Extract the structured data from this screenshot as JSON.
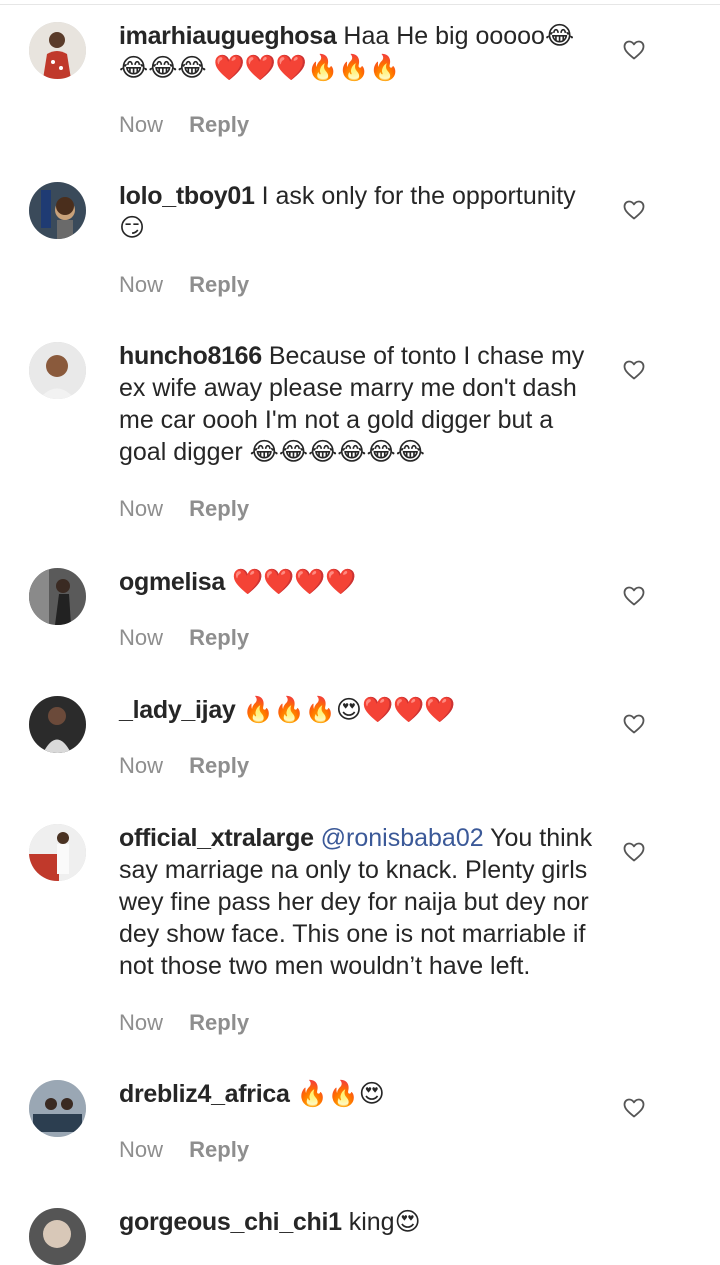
{
  "comments": [
    {
      "username": "imarhiaugueghosa",
      "text": "Haa He big ooooo😂😂😂😂 ❤️❤️❤️🔥🔥🔥",
      "time": "Now",
      "reply_label": "Reply"
    },
    {
      "username": "lolo_tboy01",
      "text": "I ask only for the opportunity 😏",
      "time": "Now",
      "reply_label": "Reply"
    },
    {
      "username": "huncho8166",
      "text": "Because of tonto I chase my ex wife away please marry me don't dash me car oooh I'm not a gold digger but a goal digger 😂😂😂😂😂😂",
      "time": "Now",
      "reply_label": "Reply"
    },
    {
      "username": "ogmelisa",
      "text": "❤️❤️❤️❤️",
      "time": "Now",
      "reply_label": "Reply"
    },
    {
      "username": "_lady_ijay",
      "text": "🔥🔥🔥😍❤️❤️❤️",
      "time": "Now",
      "reply_label": "Reply"
    },
    {
      "username": "official_xtralarge",
      "mention": "@ronisbaba02",
      "text": "You think say marriage na only to knack. Plenty girls wey fine pass her dey for naija but dey nor dey show face. This one is not marriable if not those two men wouldn’t have left.",
      "time": "Now",
      "reply_label": "Reply"
    },
    {
      "username": "drebliz4_africa",
      "text": "🔥🔥😍",
      "time": "Now",
      "reply_label": "Reply"
    },
    {
      "username": "gorgeous_chi_chi1",
      "text": "king😍"
    }
  ],
  "icons": {
    "heart": "heart-outline-icon"
  },
  "colors": {
    "username": "#262626",
    "meta": "#8e8e8e",
    "mention": "#3b5998"
  }
}
